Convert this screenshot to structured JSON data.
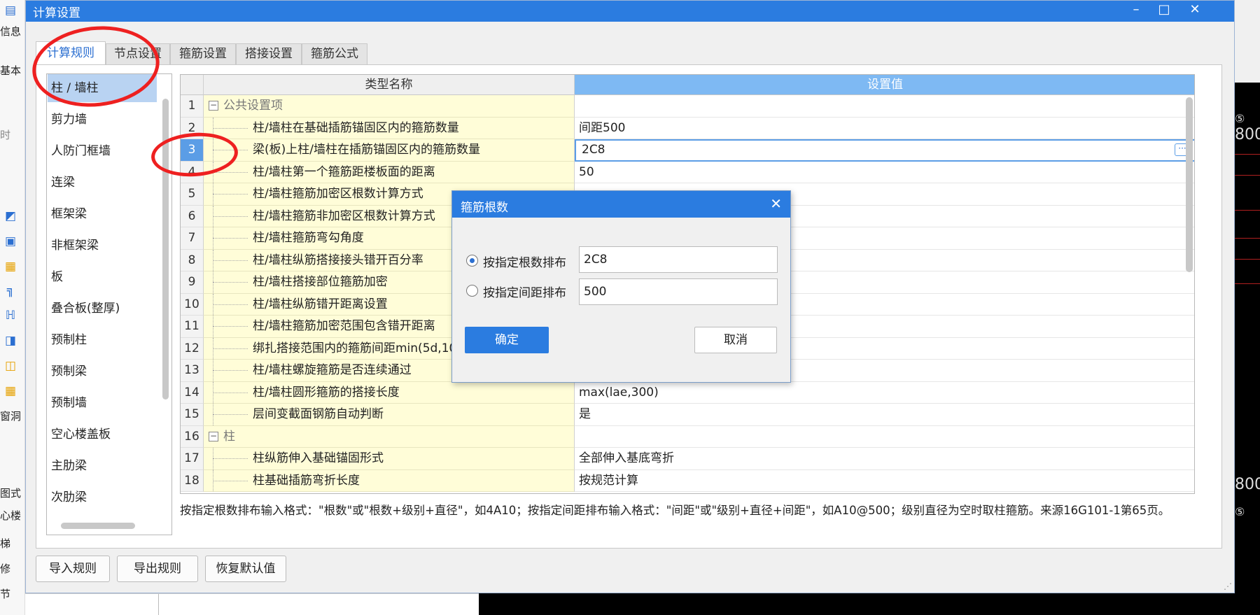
{
  "background": {
    "left_labels": [
      "信息",
      "基本",
      "时",
      "图式",
      "心楼",
      "梯",
      "修",
      "节",
      "窗洞"
    ],
    "right_numbers": [
      "800",
      "800"
    ],
    "right_symbol": "⑤"
  },
  "window": {
    "title": "计算设置",
    "minimize": "–",
    "maximize": "□",
    "close": "✕"
  },
  "tabs": [
    "计算规则",
    "节点设置",
    "箍筋设置",
    "搭接设置",
    "箍筋公式"
  ],
  "active_tab": "计算规则",
  "categories": [
    "柱 / 墙柱",
    "剪力墙",
    "人防门框墙",
    "连梁",
    "框架梁",
    "非框架梁",
    "板",
    "叠合板(整厚)",
    "预制柱",
    "预制梁",
    "预制墙",
    "空心楼盖板",
    "主肋梁",
    "次肋梁"
  ],
  "selected_category": "柱 / 墙柱",
  "grid": {
    "header_name": "类型名称",
    "header_value": "设置值",
    "selected_row": 3,
    "rows": [
      {
        "num": "1",
        "name": "公共设置项",
        "value": "",
        "group": true
      },
      {
        "num": "2",
        "name": "柱/墙柱在基础插筋锚固区内的箍筋数量",
        "value": "间距500"
      },
      {
        "num": "3",
        "name": "梁(板)上柱/墙柱在插筋锚固区内的箍筋数量",
        "value": "2C8"
      },
      {
        "num": "4",
        "name": "柱/墙柱第一个箍筋距楼板面的距离",
        "value": "50"
      },
      {
        "num": "5",
        "name": "柱/墙柱箍筋加密区根数计算方式",
        "value": ""
      },
      {
        "num": "6",
        "name": "柱/墙柱箍筋非加密区根数计算方式",
        "value": ""
      },
      {
        "num": "7",
        "name": "柱/墙柱箍筋弯勾角度",
        "value": ""
      },
      {
        "num": "8",
        "name": "柱/墙柱纵筋搭接接头错开百分率",
        "value": ""
      },
      {
        "num": "9",
        "name": "柱/墙柱搭接部位箍筋加密",
        "value": ""
      },
      {
        "num": "10",
        "name": "柱/墙柱纵筋错开距离设置",
        "value": ""
      },
      {
        "num": "11",
        "name": "柱/墙柱箍筋加密范围包含错开距离",
        "value": ""
      },
      {
        "num": "12",
        "name": "绑扎搭接范围内的箍筋间距min(5d,100)",
        "value": ""
      },
      {
        "num": "13",
        "name": "柱/墙柱螺旋箍筋是否连续通过",
        "value": ""
      },
      {
        "num": "14",
        "name": "柱/墙柱圆形箍筋的搭接长度",
        "value": "max(lae,300)"
      },
      {
        "num": "15",
        "name": "层间变截面钢筋自动判断",
        "value": "是"
      },
      {
        "num": "16",
        "name": "柱",
        "value": "",
        "group": true
      },
      {
        "num": "17",
        "name": "柱纵筋伸入基础锚固形式",
        "value": "全部伸入基底弯折"
      },
      {
        "num": "18",
        "name": "柱基础插筋弯折长度",
        "value": "按规范计算"
      }
    ]
  },
  "note": "按指定根数排布输入格式：\"根数\"或\"根数+级别+直径\"，如4A10；按指定间距排布输入格式：\"间距\"或\"级别+直径+间距\"，如A10@500；级别直径为空时取柱箍筋。来源16G101-1第65页。",
  "buttons": {
    "import": "导入规则",
    "export": "导出规则",
    "restore": "恢复默认值"
  },
  "dialog": {
    "title": "箍筋根数",
    "close": "✕",
    "option_count_label": "按指定根数排布",
    "option_count_value": "2C8",
    "option_spacing_label": "按指定间距排布",
    "option_spacing_value": "500",
    "selected_option": "count",
    "ok": "确定",
    "cancel": "取消"
  },
  "colors": {
    "titlebar": "#2b7ce0",
    "value_header": "#7eb9f3",
    "name_cell_bg": "#fffdd8",
    "selection": "#b9d3f2",
    "annotation": "#ee2020"
  }
}
